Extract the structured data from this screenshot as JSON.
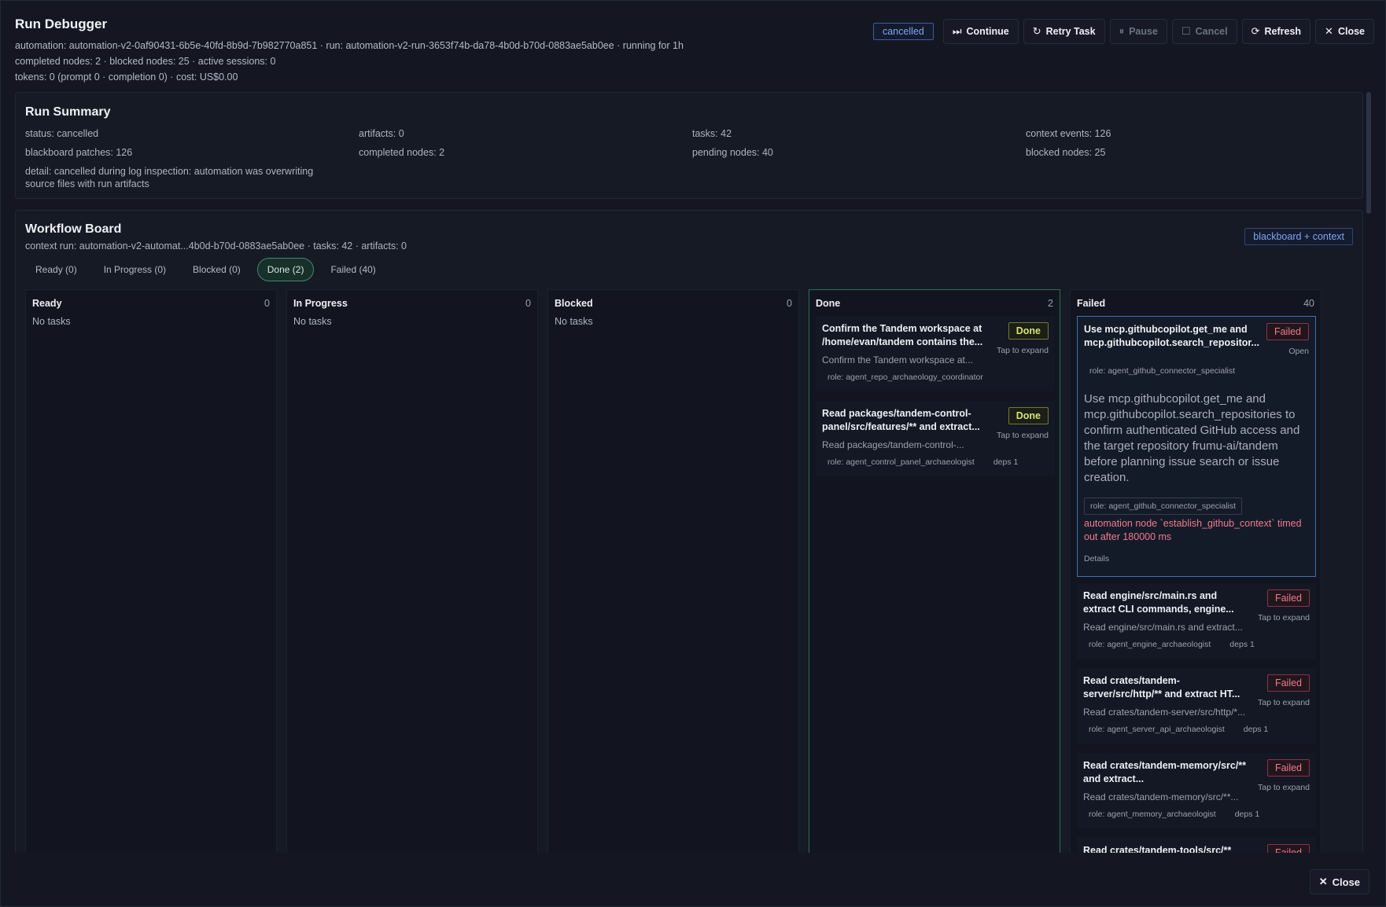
{
  "header": {
    "title": "Run Debugger",
    "line1": "automation: automation-v2-0af90431-6b5e-40fd-8b9d-7b982770a851 · run: automation-v2-run-3653f74b-da78-4b0d-b70d-0883ae5ab0ee · running for 1h",
    "line2": "completed nodes: 2 · blocked nodes: 25 · active sessions: 0",
    "line3": "tokens: 0 (prompt 0 · completion 0) · cost: US$0.00",
    "status": "cancelled",
    "buttons": {
      "continue": "Continue",
      "retry": "Retry Task",
      "pause": "Pause",
      "cancel": "Cancel",
      "refresh": "Refresh",
      "close": "Close"
    }
  },
  "summary": {
    "title": "Run Summary",
    "status": "status: cancelled",
    "artifacts": "artifacts: 0",
    "tasks": "tasks: 42",
    "context_events": "context events: 126",
    "blackboard_patches": "blackboard patches: 126",
    "completed_nodes": "completed nodes: 2",
    "pending_nodes": "pending nodes: 40",
    "blocked_nodes": "blocked nodes: 25",
    "detail": "detail: cancelled during log inspection: automation was overwriting source files with run artifacts"
  },
  "board": {
    "title": "Workflow Board",
    "subtitle": "context run: automation-v2-automat...4b0d-b70d-0883ae5ab0ee · tasks: 42 · artifacts: 0",
    "chip": "blackboard + context",
    "filters": [
      "Ready (0)",
      "In Progress (0)",
      "Blocked (0)",
      "Done (2)",
      "Failed (40)"
    ],
    "columns": {
      "ready": {
        "name": "Ready",
        "count": "0",
        "empty": "No tasks"
      },
      "in_progress": {
        "name": "In Progress",
        "count": "0",
        "empty": "No tasks"
      },
      "blocked": {
        "name": "Blocked",
        "count": "0",
        "empty": "No tasks"
      },
      "done": {
        "name": "Done",
        "count": "2"
      },
      "failed": {
        "name": "Failed",
        "count": "40"
      }
    },
    "done_tasks": [
      {
        "title": "Confirm the Tandem workspace at /home/evan/tandem contains the...",
        "badge": "Done",
        "tap": "Tap to expand",
        "desc": "Confirm the Tandem workspace at...",
        "role": "role: agent_repo_archaeology_coordinator",
        "deps": ""
      },
      {
        "title": "Read packages/tandem-control-panel/src/features/** and extract...",
        "badge": "Done",
        "tap": "Tap to expand",
        "desc": "Read packages/tandem-control-...",
        "role": "role: agent_control_panel_archaeologist",
        "deps": "deps 1"
      }
    ],
    "failed_expanded": {
      "title": "Use mcp.githubcopilot.get_me and mcp.githubcopilot.search_repositor...",
      "badge": "Failed",
      "open": "Open",
      "role": "role: agent_github_connector_specialist",
      "desc": "Use mcp.githubcopilot.get_me and mcp.githubcopilot.search_repositories to confirm authenticated GitHub access and the target repository frumu-ai/tandem before planning issue search or issue creation.",
      "error": "automation node `establish_github_context` timed out after 180000 ms",
      "details": "Details"
    },
    "failed_tasks": [
      {
        "title": "Read engine/src/main.rs and extract CLI commands, engine...",
        "badge": "Failed",
        "tap": "Tap to expand",
        "desc": "Read engine/src/main.rs and extract...",
        "role": "role: agent_engine_archaeologist",
        "deps": "deps 1"
      },
      {
        "title": "Read crates/tandem-server/src/http/** and extract HT...",
        "badge": "Failed",
        "tap": "Tap to expand",
        "desc": "Read crates/tandem-server/src/http/*...",
        "role": "role: agent_server_api_archaeologist",
        "deps": "deps 1"
      },
      {
        "title": "Read crates/tandem-memory/src/** and extract...",
        "badge": "Failed",
        "tap": "Tap to expand",
        "desc": "Read crates/tandem-memory/src/**...",
        "role": "role: agent_memory_archaeologist",
        "deps": "deps 1"
      },
      {
        "title": "Read crates/tandem-tools/src/**",
        "badge": "Failed",
        "tap": "",
        "desc": "",
        "role": "",
        "deps": ""
      }
    ]
  },
  "footer": {
    "close": "Close"
  },
  "icons": {
    "continue": "skip-forward-icon",
    "retry": "rotate-ccw-icon",
    "pause": "pause-icon",
    "cancel": "square-icon",
    "refresh": "refresh-icon",
    "close": "x-icon"
  },
  "colors": {
    "accent_blue": "#7da6f2",
    "done_green": "#3f8a6f",
    "done_badge": "#d8e36d",
    "failed_red": "#f07a8e"
  }
}
